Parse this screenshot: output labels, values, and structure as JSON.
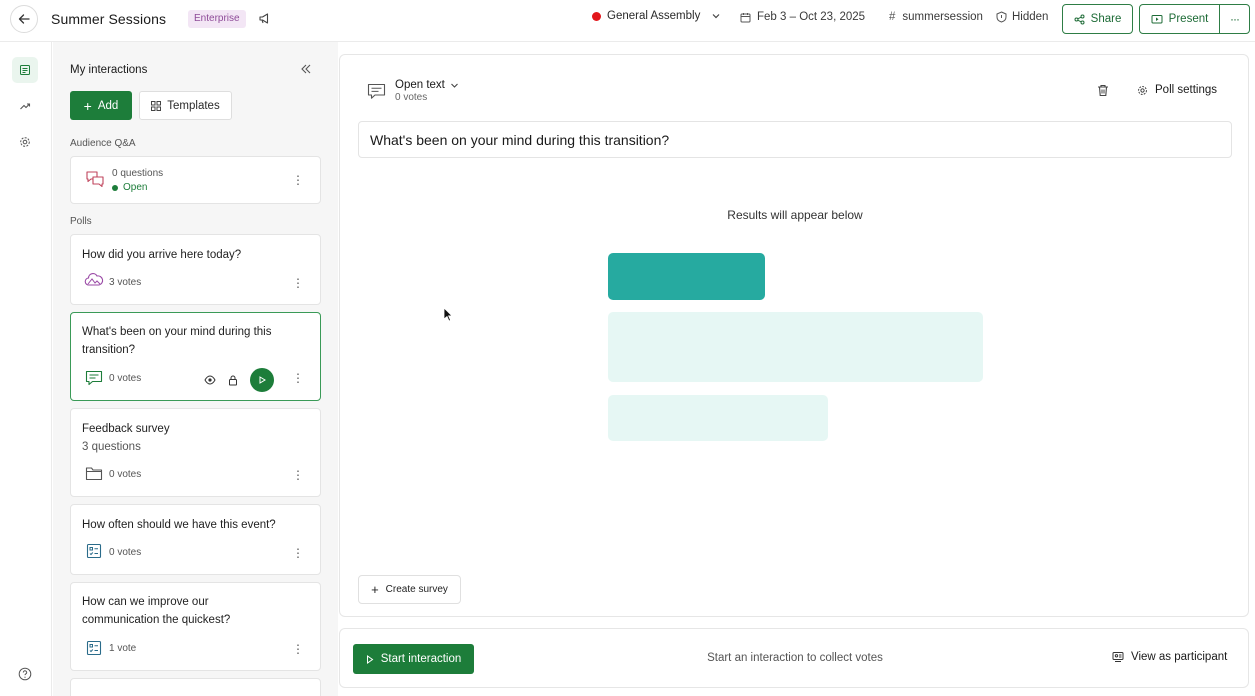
{
  "header": {
    "event_title": "Summer Sessions",
    "plan_badge": "Enterprise",
    "workspace": "General Assembly",
    "dates": "Feb 3 – Oct 23, 2025",
    "event_code": "summersession",
    "visibility": "Hidden",
    "share_label": "Share",
    "present_label": "Present"
  },
  "sidebar": {
    "title": "My interactions",
    "add_label": "Add",
    "templates_label": "Templates",
    "qa_section": "Audience Q&A",
    "qa_card": {
      "count": "0 questions",
      "status": "Open"
    },
    "polls_section": "Polls",
    "polls": [
      {
        "title": "How did you arrive here today?",
        "votes": "3 votes",
        "icon": "word-cloud-icon"
      },
      {
        "title": "What's been on your mind during this transition?",
        "votes": "0 votes",
        "icon": "open-text-icon",
        "selected": true
      },
      {
        "title": "Feedback survey",
        "subtitle": "3 questions",
        "votes": "0 votes",
        "icon": "folder-icon"
      },
      {
        "title": "How often should we have this event?",
        "votes": "0 votes",
        "icon": "multiple-choice-icon"
      },
      {
        "title": "How can we improve our communication the quickest?",
        "votes": "1 vote",
        "icon": "multiple-choice-icon"
      }
    ]
  },
  "main": {
    "type_label": "Open text",
    "type_votes": "0 votes",
    "settings_label": "Poll settings",
    "question": "What's been on your mind during this transition?",
    "results_placeholder": "Results will appear below",
    "create_survey_label": "Create survey",
    "start_label": "Start interaction",
    "hint": "Start an interaction to collect votes",
    "view_participant_label": "View as participant"
  },
  "colors": {
    "brand_green": "#1d7d3a",
    "teal": "#26aaa0",
    "teal_light": "#e6f7f4",
    "badge_bg": "#f3e6f5",
    "live_red": "#e2161b"
  }
}
